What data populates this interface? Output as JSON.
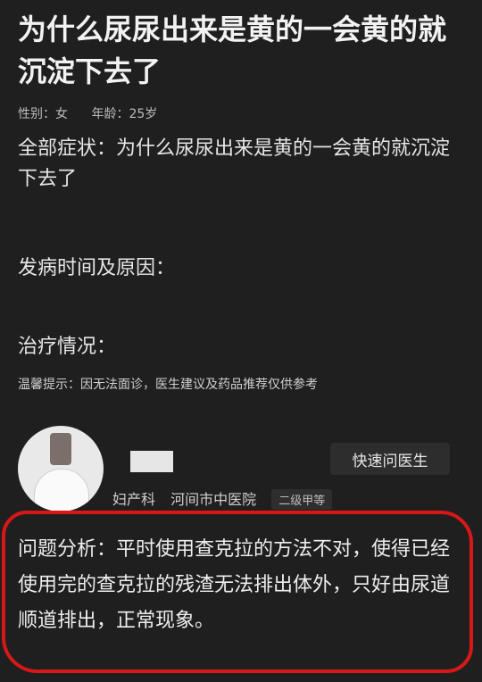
{
  "question": {
    "title": "为什么尿尿出来是黄的一会黄的就沉淀下去了",
    "gender": "性别：女",
    "age": "年龄：25岁"
  },
  "details": {
    "symptoms": "全部症状：为什么尿尿出来是黄的一会黄的就沉淀下去了",
    "onset": "发病时间及原因：",
    "treatment": "治疗情况：",
    "hint": "温馨提示：因无法面诊，医生建议及药品推荐仅供参考"
  },
  "doctor": {
    "department": "妇产科",
    "hospital": "河间市中医院",
    "grade": "二级甲等",
    "quick_ask_label": "快速问医生"
  },
  "answer": {
    "text": "问题分析：平时使用查克拉的方法不对，使得已经使用完的查克拉的残渣无法排出体外，只好由尿道顺道排出，正常现象。"
  },
  "colors": {
    "background": "#1f1f1f",
    "annotation": "#d81818"
  }
}
